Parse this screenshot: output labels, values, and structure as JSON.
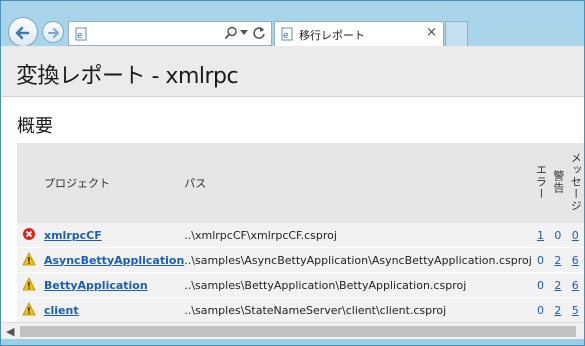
{
  "browser": {
    "tab_title": "移行レポート",
    "tab_close": "×",
    "address_value": ""
  },
  "report": {
    "title": "変換レポート - xmlrpc",
    "section": "概要",
    "columns": {
      "project": "プロジェクト",
      "path": "パス",
      "errors": "エラー",
      "warnings": "警告",
      "messages": "メッセージ"
    },
    "rows": [
      {
        "status": "error",
        "project": "xmlrpcCF",
        "path": "..\\xmlrpcCF\\xmlrpcCF.csproj",
        "errors": "1",
        "warnings": "0",
        "messages": "0"
      },
      {
        "status": "warning",
        "project": "AsyncBettyApplication",
        "path": "..\\samples\\AsyncBettyApplication\\AsyncBettyApplication.csproj",
        "errors": "0",
        "warnings": "2",
        "messages": "6"
      },
      {
        "status": "warning",
        "project": "BettyApplication",
        "path": "..\\samples\\BettyApplication\\BettyApplication.csproj",
        "errors": "0",
        "warnings": "2",
        "messages": "6"
      },
      {
        "status": "warning",
        "project": "client",
        "path": "..\\samples\\StateNameServer\\client\\client.csproj",
        "errors": "0",
        "warnings": "2",
        "messages": "5"
      }
    ]
  },
  "colors": {
    "link": "#1a5fb4",
    "error": "#d9261c",
    "warning": "#f2c200",
    "chrome": "#a9d5ea"
  }
}
